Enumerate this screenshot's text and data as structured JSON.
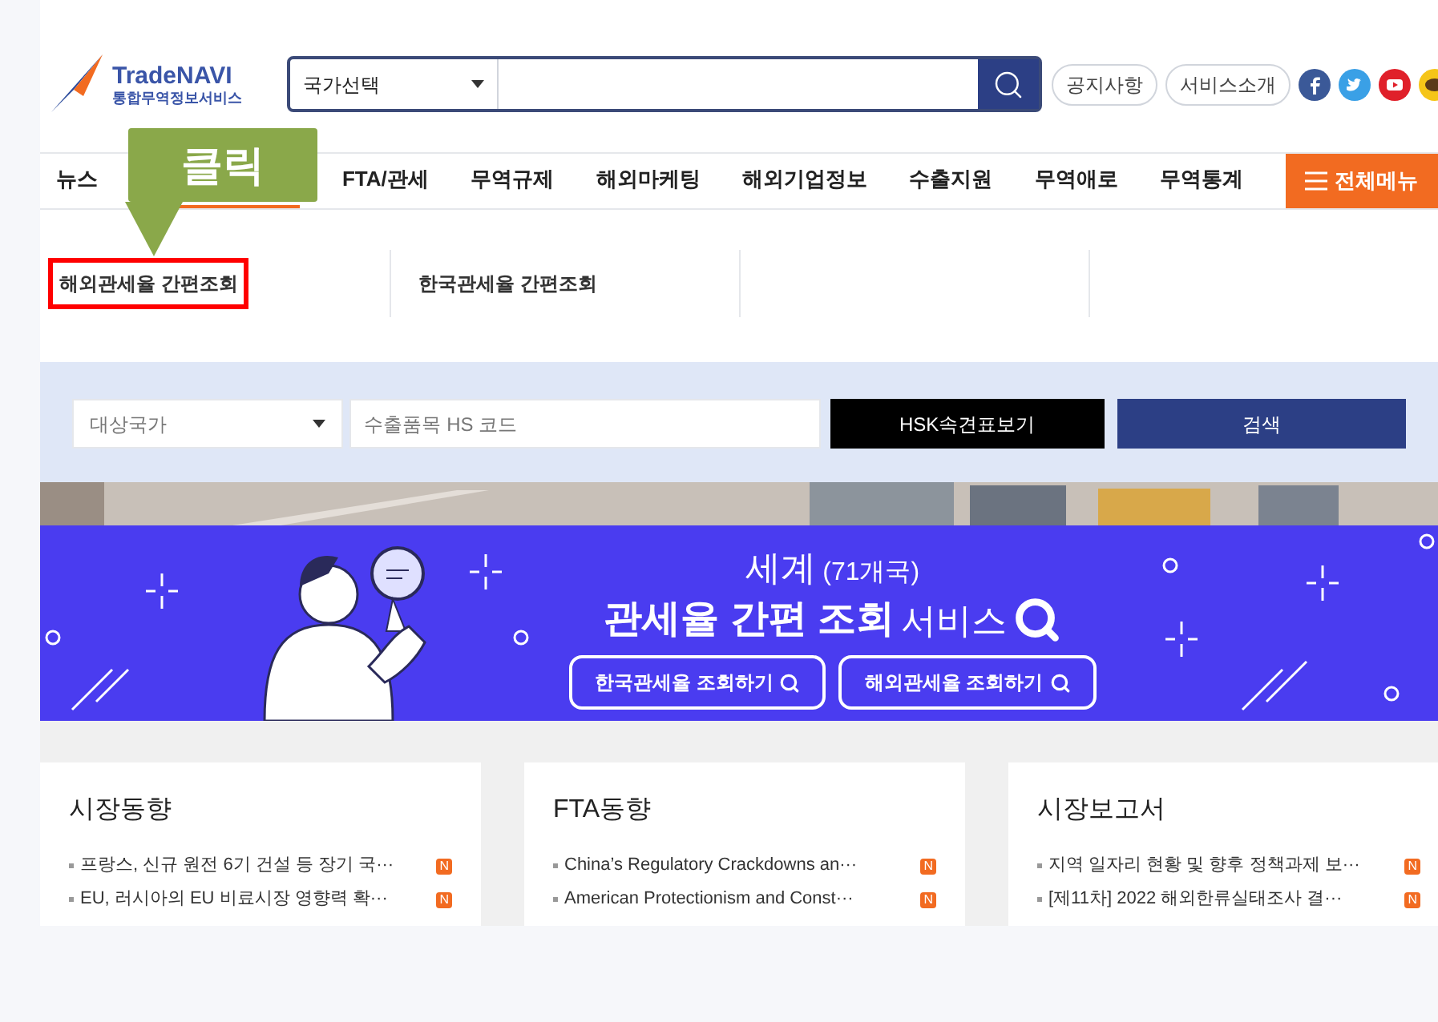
{
  "header": {
    "logo": {
      "name": "TradeNAVI",
      "subtitle": "통합무역정보서비스"
    },
    "country_select": {
      "value": "국가선택"
    },
    "pills": [
      "공지사항",
      "서비스소개"
    ]
  },
  "nav": {
    "items": [
      {
        "label": "뉴스",
        "selected": false
      },
      {
        "selected": true
      },
      {
        "label": "FTA/관세",
        "selected": false
      },
      {
        "label": "무역규제",
        "selected": false
      },
      {
        "label": "해외마케팅",
        "selected": false
      },
      {
        "label": "해외기업정보",
        "selected": false
      },
      {
        "label": "수출지원",
        "selected": false
      },
      {
        "label": "무역애로",
        "selected": false
      },
      {
        "label": "무역통계",
        "selected": false
      }
    ],
    "all_menu": "전체메뉴"
  },
  "callout": {
    "text": "클릭"
  },
  "submenu": [
    {
      "label": "해외관세율 간편조회",
      "highlighted": true
    },
    {
      "label": "한국관세율 간편조회",
      "highlighted": false
    }
  ],
  "search_form": {
    "country_select": {
      "placeholder": "대상국가"
    },
    "hs_field": {
      "placeholder": "수출품목 HS 코드"
    },
    "hsk_button": "HSK속견표보기",
    "search_button": "검색"
  },
  "banner": {
    "line1": "세계",
    "line1_note": "(71개국)",
    "line2_bold": "관세율 간편 조회",
    "line2_rest": "서비스",
    "buttons": [
      "한국관세율 조회하기",
      "해외관세율 조회하기"
    ]
  },
  "cards": [
    {
      "title": "시장동향",
      "items": [
        {
          "text": "프랑스, 신규 원전 6기 건설 등 장기 국···",
          "badge": "N"
        },
        {
          "text": "EU, 러시아의 EU 비료시장 영향력 확···",
          "badge": "N"
        }
      ]
    },
    {
      "title": "FTA동향",
      "items": [
        {
          "text": "China’s Regulatory Crackdowns an···",
          "badge": "N"
        },
        {
          "text": "American Protectionism and Const···",
          "badge": "N"
        }
      ]
    },
    {
      "title": "시장보고서",
      "items": [
        {
          "text": "지역 일자리 현황 및 향후 정책과제 보···",
          "badge": "N"
        },
        {
          "text": "[제11차] 2022 해외한류실태조사 결···",
          "badge": "N"
        }
      ]
    }
  ]
}
